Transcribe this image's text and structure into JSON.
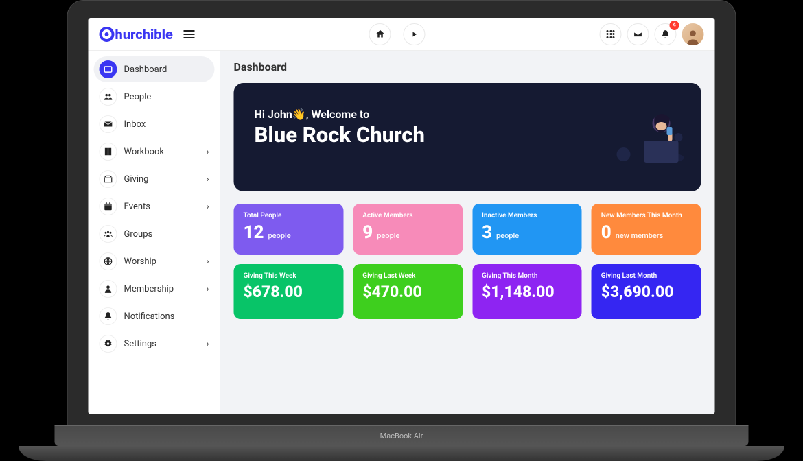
{
  "brand": "hurchible",
  "header": {
    "notification_badge": "4"
  },
  "sidebar": {
    "items": [
      {
        "label": "Dashboard",
        "icon": "dashboard",
        "active": true,
        "expandable": false
      },
      {
        "label": "People",
        "icon": "people",
        "active": false,
        "expandable": false
      },
      {
        "label": "Inbox",
        "icon": "inbox",
        "active": false,
        "expandable": false
      },
      {
        "label": "Workbook",
        "icon": "workbook",
        "active": false,
        "expandable": true
      },
      {
        "label": "Giving",
        "icon": "giving",
        "active": false,
        "expandable": true
      },
      {
        "label": "Events",
        "icon": "events",
        "active": false,
        "expandable": true
      },
      {
        "label": "Groups",
        "icon": "groups",
        "active": false,
        "expandable": false
      },
      {
        "label": "Worship",
        "icon": "worship",
        "active": false,
        "expandable": true
      },
      {
        "label": "Membership",
        "icon": "membership",
        "active": false,
        "expandable": true
      },
      {
        "label": "Notifications",
        "icon": "notifications",
        "active": false,
        "expandable": false
      },
      {
        "label": "Settings",
        "icon": "settings",
        "active": false,
        "expandable": true
      }
    ]
  },
  "page": {
    "title": "Dashboard",
    "welcome": {
      "greeting": "Hi John👋, Welcome to",
      "church_name": "Blue Rock Church"
    },
    "stats": [
      {
        "label": "Total People",
        "value": "12",
        "unit": "people",
        "color": "c-purple",
        "type": "count"
      },
      {
        "label": "Active Members",
        "value": "9",
        "unit": "people",
        "color": "c-pink",
        "type": "count"
      },
      {
        "label": "Inactive Members",
        "value": "3",
        "unit": "people",
        "color": "c-blue",
        "type": "count"
      },
      {
        "label": "New Members This Month",
        "value": "0",
        "unit": "new members",
        "color": "c-orange",
        "type": "count"
      },
      {
        "label": "Giving This Week",
        "value": "$678.00",
        "unit": "",
        "color": "c-green1",
        "type": "giving"
      },
      {
        "label": "Giving Last Week",
        "value": "$470.00",
        "unit": "",
        "color": "c-green2",
        "type": "giving"
      },
      {
        "label": "Giving This Month",
        "value": "$1,148.00",
        "unit": "",
        "color": "c-purple2",
        "type": "giving"
      },
      {
        "label": "Giving Last Month",
        "value": "$3,690.00",
        "unit": "",
        "color": "c-indigo",
        "type": "giving"
      }
    ]
  },
  "frame": {
    "label": "MacBook Air"
  }
}
